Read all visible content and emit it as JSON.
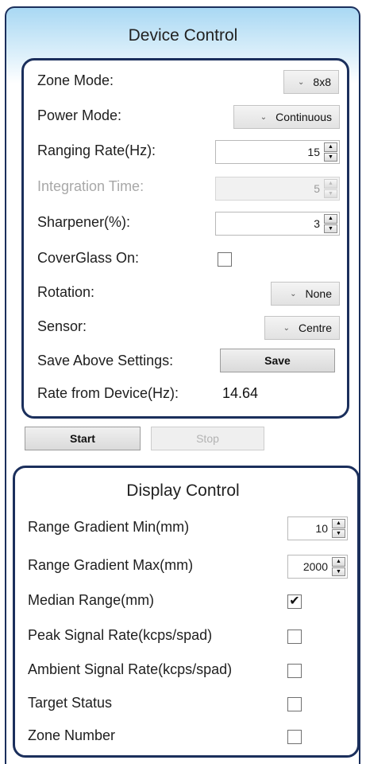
{
  "device_control": {
    "title": "Device Control",
    "zone_mode": {
      "label": "Zone Mode:",
      "value": "8x8"
    },
    "power_mode": {
      "label": "Power Mode:",
      "value": "Continuous"
    },
    "ranging_rate": {
      "label": "Ranging Rate(Hz):",
      "value": "15"
    },
    "integration_time": {
      "label": "Integration Time:",
      "value": "5"
    },
    "sharpener": {
      "label": "Sharpener(%):",
      "value": "3"
    },
    "coverglass": {
      "label": "CoverGlass On:",
      "checked": false
    },
    "rotation": {
      "label": "Rotation:",
      "value": "None"
    },
    "sensor": {
      "label": "Sensor:",
      "value": "Centre"
    },
    "save_settings": {
      "label": "Save Above Settings:",
      "button": "Save"
    },
    "rate_from_device": {
      "label": "Rate from Device(Hz):",
      "value": "14.64"
    }
  },
  "actions": {
    "start": "Start",
    "stop": "Stop"
  },
  "display_control": {
    "title": "Display Control",
    "range_min": {
      "label": "Range Gradient Min(mm)",
      "value": "10"
    },
    "range_max": {
      "label": "Range Gradient Max(mm)",
      "value": "2000"
    },
    "median_range": {
      "label": "Median Range(mm)",
      "checked": true
    },
    "peak_signal": {
      "label": "Peak Signal Rate(kcps/spad)",
      "checked": false
    },
    "ambient_signal": {
      "label": "Ambient Signal Rate(kcps/spad)",
      "checked": false
    },
    "target_status": {
      "label": "Target Status",
      "checked": false
    },
    "zone_number": {
      "label": "Zone Number",
      "checked": false
    }
  },
  "icons": {
    "dropdown": "chevron-down-icon",
    "spin_up": "arrow-up-icon",
    "spin_down": "arrow-down-icon",
    "check": "checkmark-icon"
  },
  "colors": {
    "border": "#1b2f5c",
    "header_gradient": "#a9d8f3"
  }
}
